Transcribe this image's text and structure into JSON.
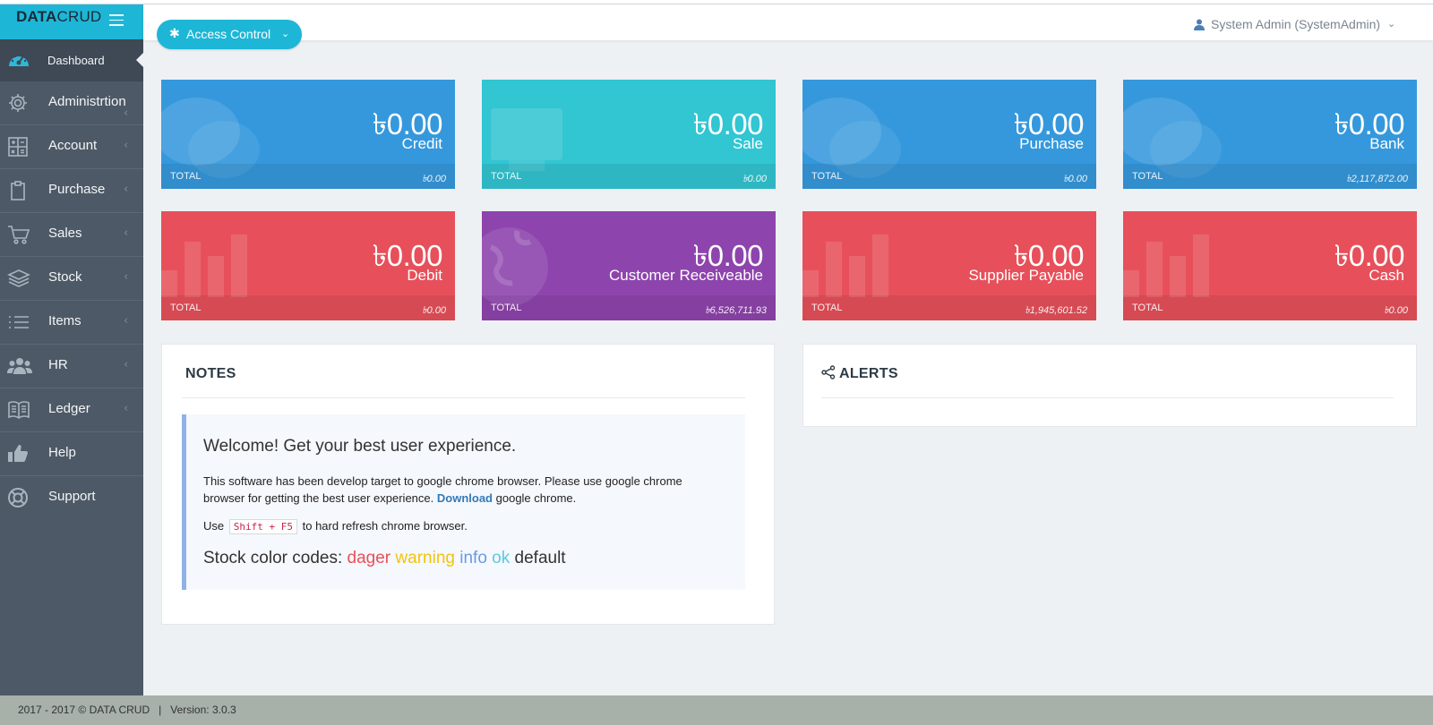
{
  "brand": {
    "bold": "DATA",
    "light": "CRUD"
  },
  "sidebar": {
    "items": [
      {
        "label": "Dashboard",
        "icon": "dashboard-gauge-icon"
      },
      {
        "label": "Administrtion",
        "icon": "gear-icon"
      },
      {
        "label": "Account",
        "icon": "calculator-icon"
      },
      {
        "label": "Purchase",
        "icon": "clipboard-icon"
      },
      {
        "label": "Sales",
        "icon": "cart-icon"
      },
      {
        "label": "Stock",
        "icon": "layers-icon"
      },
      {
        "label": "Items",
        "icon": "list-icon"
      },
      {
        "label": "HR",
        "icon": "users-icon"
      },
      {
        "label": "Ledger",
        "icon": "book-icon"
      },
      {
        "label": "Help",
        "icon": "thumbs-up-icon"
      },
      {
        "label": "Support",
        "icon": "lifebuoy-icon"
      }
    ]
  },
  "header": {
    "access_button": "Access Control",
    "user": "System Admin (SystemAdmin)"
  },
  "tiles": [
    {
      "amount": "৳0.00",
      "label": "Credit",
      "total_label": "TOTAL",
      "total": "৳0.00",
      "color": "#3598dc"
    },
    {
      "amount": "৳0.00",
      "label": "Sale",
      "total_label": "TOTAL",
      "total": "৳0.00",
      "color": "#32c5d2"
    },
    {
      "amount": "৳0.00",
      "label": "Purchase",
      "total_label": "TOTAL",
      "total": "৳0.00",
      "color": "#3598dc"
    },
    {
      "amount": "৳0.00",
      "label": "Bank",
      "total_label": "TOTAL",
      "total": "৳2,117,872.00",
      "color": "#3598dc"
    },
    {
      "amount": "৳0.00",
      "label": "Debit",
      "total_label": "TOTAL",
      "total": "৳0.00",
      "color": "#e7505a"
    },
    {
      "amount": "৳0.00",
      "label": "Customer Receiveable",
      "total_label": "TOTAL",
      "total": "৳6,526,711.93",
      "color": "#8e44ad"
    },
    {
      "amount": "৳0.00",
      "label": "Supplier Payable",
      "total_label": "TOTAL",
      "total": "৳1,945,601.52",
      "color": "#e7505a"
    },
    {
      "amount": "৳0.00",
      "label": "Cash",
      "total_label": "TOTAL",
      "total": "৳0.00",
      "color": "#e7505a"
    }
  ],
  "notes": {
    "title": "NOTES",
    "welcome": "Welcome! Get your best user experience.",
    "text_before_link": "This software has been develop target to google chrome browser. Please use google chrome browser for getting the best user experience.",
    "link": "Download",
    "text_after_link": "google chrome.",
    "use_prefix": "Use",
    "shortcut": "Shift + F5",
    "use_suffix": "to hard refresh chrome browser.",
    "codes_label": "Stock color codes:",
    "codes": {
      "danger": "dager",
      "warning": "warning",
      "info": "info",
      "ok": "ok",
      "default": "default"
    }
  },
  "alerts": {
    "title": "ALERTS"
  },
  "footer": {
    "text": "2017 - 2017 © DATA CRUD   |   Version: 3.0.3"
  }
}
